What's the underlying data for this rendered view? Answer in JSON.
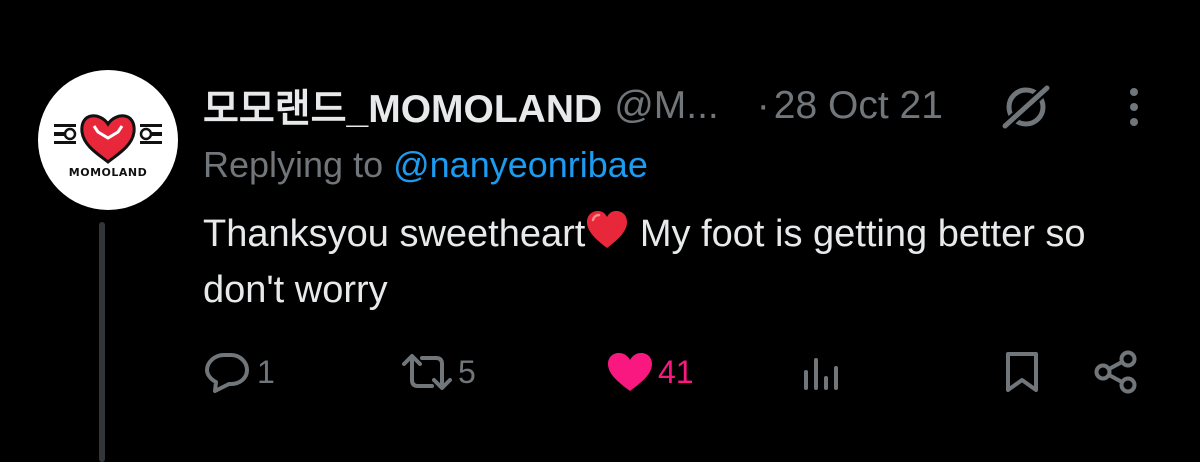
{
  "tweet": {
    "display_name": "모모랜드_MOMOLAND",
    "handle": "@M...",
    "separator": "·",
    "date": "28 Oct 21",
    "replying_prefix": "Replying to ",
    "replying_to": "@nanyeonribae",
    "text_before_emoji": "Thanksyou sweetheart",
    "text_after_emoji": " My foot is getting better so don't worry",
    "avatar_logo_text": "MOMOLAND"
  },
  "actions": {
    "reply_count": "1",
    "retweet_count": "5",
    "like_count": "41",
    "liked": true
  },
  "icons": {
    "reply": "reply-icon",
    "retweet": "retweet-icon",
    "like": "heart-icon",
    "views": "analytics-icon",
    "bookmark": "bookmark-icon",
    "share": "share-icon",
    "grok": "grok-icon",
    "more": "more-icon"
  },
  "colors": {
    "background": "#000000",
    "text_primary": "#e7e9ea",
    "text_secondary": "#71767b",
    "link": "#1d9bf0",
    "like": "#f91880",
    "emoji_heart": "#e8283a"
  }
}
